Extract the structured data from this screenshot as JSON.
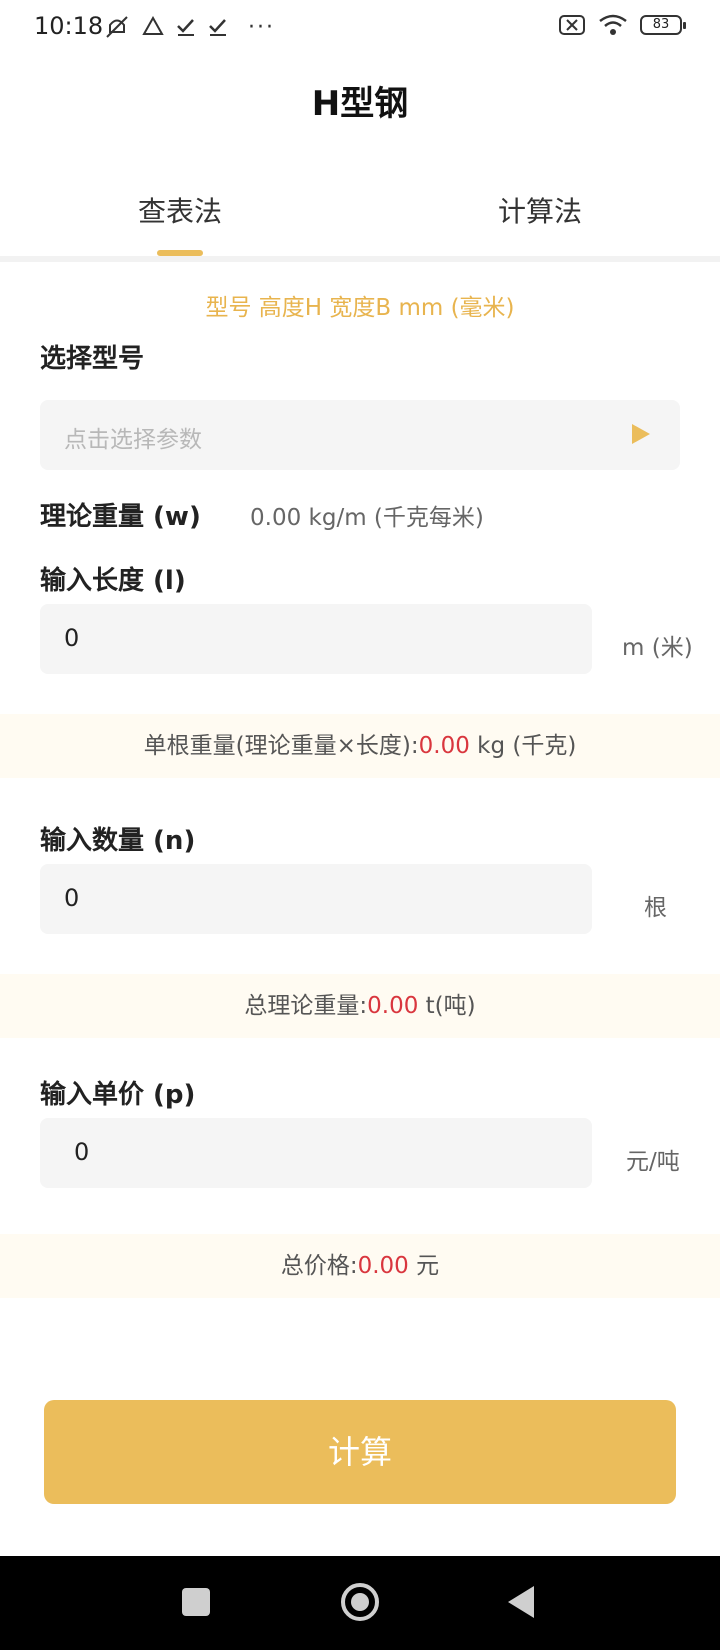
{
  "status_bar": {
    "time": "10:18",
    "battery": "83",
    "icons": [
      "mute-icon",
      "drive-icon",
      "check-icon",
      "check-icon",
      "more-dots-icon",
      "no-sim-icon",
      "wifi-icon",
      "battery-icon"
    ]
  },
  "page": {
    "title": "H型钢"
  },
  "tabs": [
    {
      "label": "查表法",
      "active": true
    },
    {
      "label": "计算法",
      "active": false
    }
  ],
  "hint": "型号 高度H 宽度B  mm (毫米)",
  "model": {
    "label": "选择型号",
    "placeholder": "点击选择参数"
  },
  "weight": {
    "label": "理论重量 (w)",
    "value": "0.00 kg/m (千克每米)"
  },
  "length": {
    "label": "输入长度 (l)",
    "value": "0",
    "unit": "m (米)"
  },
  "single_weight": {
    "prefix": "单根重量(理论重量×长度):",
    "value": "0.00",
    "suffix": " kg (千克)"
  },
  "quantity": {
    "label": "输入数量  (n)",
    "value": "0",
    "unit": "根"
  },
  "total_weight": {
    "prefix": "总理论重量:",
    "value": "0.00",
    "suffix": " t(吨)"
  },
  "price": {
    "label": "输入单价  (p)",
    "value": "0",
    "unit": "元/吨"
  },
  "total_price": {
    "prefix": "总价格:",
    "value": "0.00",
    "suffix": " 元"
  },
  "calculate_button": "计算",
  "colors": {
    "accent": "#ebbd5b",
    "highlight_value": "#d9363e",
    "result_band": "#fffbf2"
  }
}
